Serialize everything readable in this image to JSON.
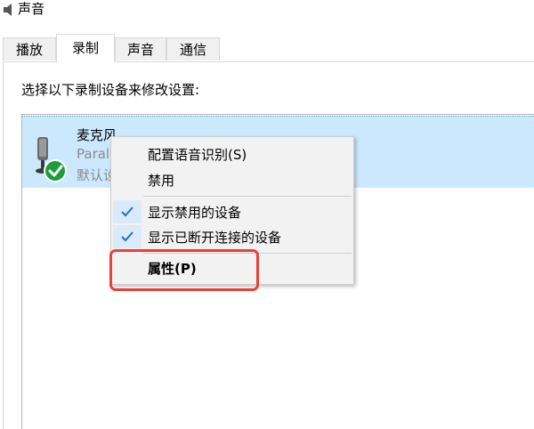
{
  "window": {
    "title": "声音"
  },
  "tabs": [
    {
      "label": "播放"
    },
    {
      "label": "录制",
      "active": true
    },
    {
      "label": "声音"
    },
    {
      "label": "通信"
    }
  ],
  "panel": {
    "instruction": "选择以下录制设备来修改设置:"
  },
  "device": {
    "name": "麦克风",
    "subtitle": "Paral",
    "status": "默认设",
    "icon": "microphone-icon",
    "status_icon": "green-check-icon"
  },
  "context_menu": {
    "items": [
      {
        "label": "配置语音识别(S)",
        "checked": false
      },
      {
        "label": "禁用",
        "checked": false
      },
      {
        "label": "显示禁用的设备",
        "checked": true
      },
      {
        "label": "显示已断开连接的设备",
        "checked": true
      },
      {
        "label": "属性(P)",
        "checked": false,
        "bold": true,
        "highlighted": true
      }
    ]
  },
  "colors": {
    "selection": "#cce8ff",
    "menu_bg": "#f2f2f2",
    "check": "#1a73c8",
    "highlight_border": "#e8413a",
    "status_green": "#1e9e3a"
  }
}
